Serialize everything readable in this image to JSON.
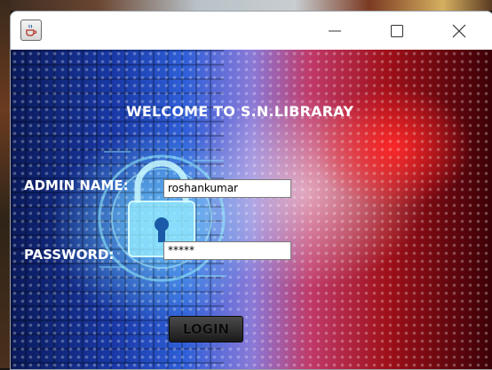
{
  "window": {
    "app_icon": "java-cup-icon",
    "controls": [
      "minimize-icon",
      "maximize-icon",
      "close-icon"
    ]
  },
  "form": {
    "title": "WELCOME TO S.N.LIBRARAY",
    "admin_label": "ADMIN NAME:",
    "admin_value": "roshankumar",
    "password_label": "PASSWORD:",
    "password_value": "*****",
    "login_label": "LOGIN"
  },
  "colors": {
    "label_text": "#ffffff",
    "accent_red": "#ff2020",
    "accent_blue": "#2f5fd8",
    "button_bg": "#2a2a2a"
  }
}
